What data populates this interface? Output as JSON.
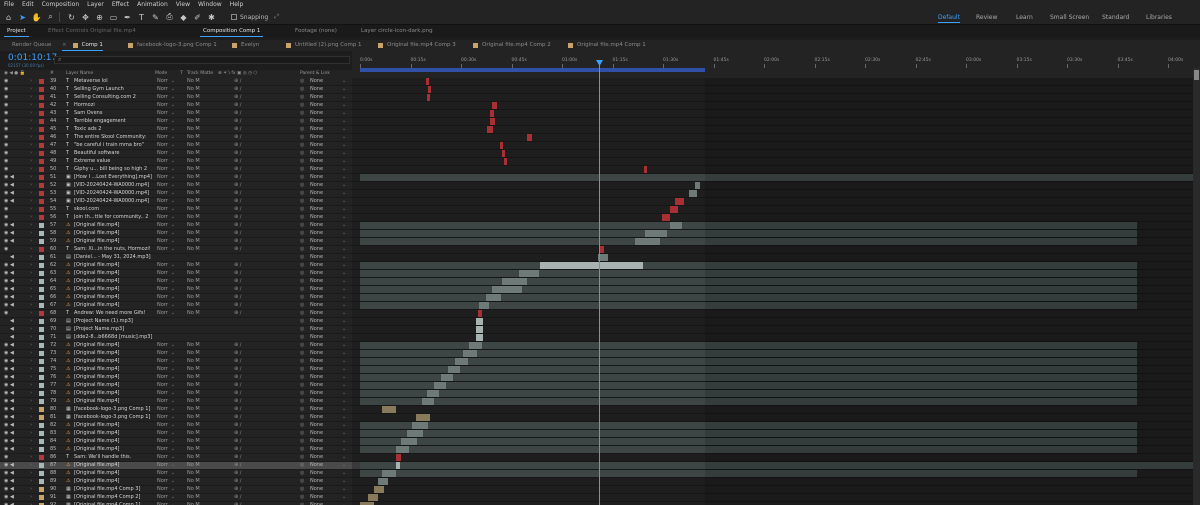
{
  "menu": [
    "File",
    "Edit",
    "Composition",
    "Layer",
    "Effect",
    "Animation",
    "View",
    "Window",
    "Help"
  ],
  "toolbar": {
    "tools": [
      "home-icon",
      "selection-tool-icon",
      "hand-tool-icon",
      "zoom-tool-icon",
      "rotate-tool-icon",
      "camera-tool-icon",
      "pan-behind-icon",
      "shape-tool-icon",
      "pen-tool-icon",
      "type-tool-icon",
      "brush-tool-icon",
      "clone-stamp-icon",
      "eraser-tool-icon",
      "roto-brush-icon",
      "puppet-pin-icon"
    ],
    "snapping": "Snapping",
    "workspaces": [
      "Default",
      "Review",
      "Learn",
      "Small Screen",
      "Standard",
      "Libraries"
    ],
    "active_workspace": "Default"
  },
  "panel_tabs": [
    {
      "label": "Project",
      "active": true
    },
    {
      "label": "Effect Controls Original file.mp4",
      "active": false
    },
    {
      "label": "Composition Comp 1",
      "active": true
    },
    {
      "label": "Footage (none)",
      "active": false
    },
    {
      "label": "Layer  circle-icon-dark.png",
      "active": false
    }
  ],
  "comp_tabs": [
    {
      "label": "Render Queue",
      "active": false
    },
    {
      "label": "Comp 1",
      "active": true
    },
    {
      "label": "facebook-logo-3.png Comp 1",
      "active": false
    },
    {
      "label": "Evelyn",
      "active": false
    },
    {
      "label": "Untitled (2).png Comp 1",
      "active": false
    },
    {
      "label": "Original file.mp4 Comp 3",
      "active": false
    },
    {
      "label": "Original file.mp4 Comp 2",
      "active": false
    },
    {
      "label": "Original file.mp4 Comp 1",
      "active": false
    }
  ],
  "timeline": {
    "timecode": "0:01:10:17",
    "frame_sub": "02157 (30.00 fps)",
    "search_placeholder": "⌕",
    "columns": {
      "num": "#",
      "layer_name": "Layer Name",
      "mode": "Mode",
      "t": "T",
      "track_matte": "Track Matte",
      "switches": "⊕ ✶ \\ fx ▣ ◎ ◷ ⬡",
      "parent": "Parent & Link"
    },
    "ruler": [
      "0:00s",
      "00:15s",
      "00:30s",
      "00:45s",
      "01:00s",
      "01:15s",
      "01:30s",
      "01:45s",
      "02:00s",
      "02:15s",
      "02:30s",
      "02:45s",
      "03:00s",
      "03:15s",
      "03:30s",
      "03:45s",
      "04:00s"
    ],
    "mode_text": "Norr",
    "track_text": "No M",
    "parent_text": "None",
    "selected_layer": 87
  },
  "layers": [
    {
      "num": "39",
      "name": "Metaverse lol",
      "type": "T",
      "label": "#b43a3a"
    },
    {
      "num": "40",
      "name": "Selling Gym Launch",
      "type": "T",
      "label": "#b43a3a"
    },
    {
      "num": "41",
      "name": "Selling Consulting.com 2",
      "type": "T",
      "label": "#b43a3a"
    },
    {
      "num": "42",
      "name": "Hormozi",
      "type": "T",
      "label": "#b43a3a"
    },
    {
      "num": "43",
      "name": "Sam Ovens",
      "type": "T",
      "label": "#b43a3a"
    },
    {
      "num": "44",
      "name": "Terrible engagement",
      "type": "T",
      "label": "#b43a3a"
    },
    {
      "num": "45",
      "name": "Toxic ads 2",
      "type": "T",
      "label": "#b43a3a"
    },
    {
      "num": "46",
      "name": "The entire Skool Community:",
      "type": "T",
      "label": "#b43a3a"
    },
    {
      "num": "47",
      "name": "\"be careful i train mma bro\"",
      "type": "T",
      "label": "#b43a3a"
    },
    {
      "num": "48",
      "name": "Beautiful software",
      "type": "T",
      "label": "#b43a3a"
    },
    {
      "num": "49",
      "name": "Extreme value",
      "type": "T",
      "label": "#b43a3a"
    },
    {
      "num": "50",
      "name": "Giphy u... bill being so high 2",
      "type": "T",
      "label": "#b43a3a"
    },
    {
      "num": "51",
      "name": "[How I ...Lost Everything].mp4]",
      "type": "▣",
      "label": "#b43a3a"
    },
    {
      "num": "52",
      "name": "[VID-20240424-WA0000.mp4]",
      "type": "▣",
      "label": "#b43a3a"
    },
    {
      "num": "53",
      "name": "[VID-20240424-WA0000.mp4]",
      "type": "▣",
      "label": "#b43a3a"
    },
    {
      "num": "54",
      "name": "[VID-20240424-WA0000.mp4]",
      "type": "▣",
      "label": "#b43a3a"
    },
    {
      "num": "55",
      "name": "skool.com",
      "type": "T",
      "label": "#b43a3a"
    },
    {
      "num": "56",
      "name": "Join th...ttle for community.. 2",
      "type": "T",
      "label": "#b43a3a"
    },
    {
      "num": "57",
      "name": "[Original file.mp4]",
      "type": "⚠",
      "label": "#a8b8b8"
    },
    {
      "num": "58",
      "name": "[Original file.mp4]",
      "type": "⚠",
      "label": "#a8b8b8"
    },
    {
      "num": "59",
      "name": "[Original file.mp4]",
      "type": "⚠",
      "label": "#a8b8b8"
    },
    {
      "num": "60",
      "name": "Sam: Xi...in the nuts, Hormozi!",
      "type": "T",
      "label": "#b43a3a"
    },
    {
      "num": "61",
      "name": "[Daniel... - May 31, 2024.mp3]",
      "type": "▤",
      "label": "#a8b8b8"
    },
    {
      "num": "62",
      "name": "[Original file.mp4]",
      "type": "⚠",
      "label": "#a8b8b8"
    },
    {
      "num": "63",
      "name": "[Original file.mp4]",
      "type": "⚠",
      "label": "#a8b8b8"
    },
    {
      "num": "64",
      "name": "[Original file.mp4]",
      "type": "⚠",
      "label": "#a8b8b8"
    },
    {
      "num": "65",
      "name": "[Original file.mp4]",
      "type": "⚠",
      "label": "#a8b8b8"
    },
    {
      "num": "66",
      "name": "[Original file.mp4]",
      "type": "⚠",
      "label": "#a8b8b8"
    },
    {
      "num": "67",
      "name": "[Original file.mp4]",
      "type": "⚠",
      "label": "#a8b8b8"
    },
    {
      "num": "68",
      "name": "Andrew: We need more Gifs!",
      "type": "T",
      "label": "#b43a3a"
    },
    {
      "num": "69",
      "name": "[Project Name (1).mp3]",
      "type": "▤",
      "label": "#a8b8b8"
    },
    {
      "num": "70",
      "name": "[Project Name.mp3]",
      "type": "▤",
      "label": "#a8b8b8"
    },
    {
      "num": "71",
      "name": "[dde2-8...b6668d [music].mp3]",
      "type": "▤",
      "label": "#a8b8b8"
    },
    {
      "num": "72",
      "name": "[Original file.mp4]",
      "type": "⚠",
      "label": "#a8b8b8"
    },
    {
      "num": "73",
      "name": "[Original file.mp4]",
      "type": "⚠",
      "label": "#a8b8b8"
    },
    {
      "num": "74",
      "name": "[Original file.mp4]",
      "type": "⚠",
      "label": "#a8b8b8"
    },
    {
      "num": "75",
      "name": "[Original file.mp4]",
      "type": "⚠",
      "label": "#a8b8b8"
    },
    {
      "num": "76",
      "name": "[Original file.mp4]",
      "type": "⚠",
      "label": "#a8b8b8"
    },
    {
      "num": "77",
      "name": "[Original file.mp4]",
      "type": "⚠",
      "label": "#a8b8b8"
    },
    {
      "num": "78",
      "name": "[Original file.mp4]",
      "type": "⚠",
      "label": "#a8b8b8"
    },
    {
      "num": "79",
      "name": "[Original file.mp4]",
      "type": "⚠",
      "label": "#a8b8b8"
    },
    {
      "num": "80",
      "name": "[facebook-logo-3.png Comp 1]",
      "type": "▦",
      "label": "#c9a36a"
    },
    {
      "num": "81",
      "name": "[facebook-logo-3.png Comp 1]",
      "type": "▦",
      "label": "#c9a36a"
    },
    {
      "num": "82",
      "name": "[Original file.mp4]",
      "type": "⚠",
      "label": "#a8b8b8"
    },
    {
      "num": "83",
      "name": "[Original file.mp4]",
      "type": "⚠",
      "label": "#a8b8b8"
    },
    {
      "num": "84",
      "name": "[Original file.mp4]",
      "type": "⚠",
      "label": "#a8b8b8"
    },
    {
      "num": "85",
      "name": "[Original file.mp4]",
      "type": "⚠",
      "label": "#a8b8b8"
    },
    {
      "num": "86",
      "name": "Sam: We'll handle this.",
      "type": "T",
      "label": "#b43a3a"
    },
    {
      "num": "87",
      "name": "[Original file.mp4]",
      "type": "⚠",
      "label": "#a8b8b8"
    },
    {
      "num": "88",
      "name": "[Original file.mp4]",
      "type": "⚠",
      "label": "#a8b8b8"
    },
    {
      "num": "89",
      "name": "[Original file.mp4]",
      "type": "⚠",
      "label": "#a8b8b8"
    },
    {
      "num": "90",
      "name": "[Original file.mp4 Comp 3]",
      "type": "▦",
      "label": "#c9a36a"
    },
    {
      "num": "91",
      "name": "[Original file.mp4 Comp 2]",
      "type": "▦",
      "label": "#c9a36a"
    },
    {
      "num": "92",
      "name": "[Original file.mp4 Comp 1]",
      "type": "▦",
      "label": "#c9a36a"
    }
  ],
  "colors": {
    "accent": "#3ba0ff",
    "text_layer_bar": "#a82f33",
    "video_layer_bar": "#6d7a78",
    "precomp_bar": "#8a7a5c"
  }
}
